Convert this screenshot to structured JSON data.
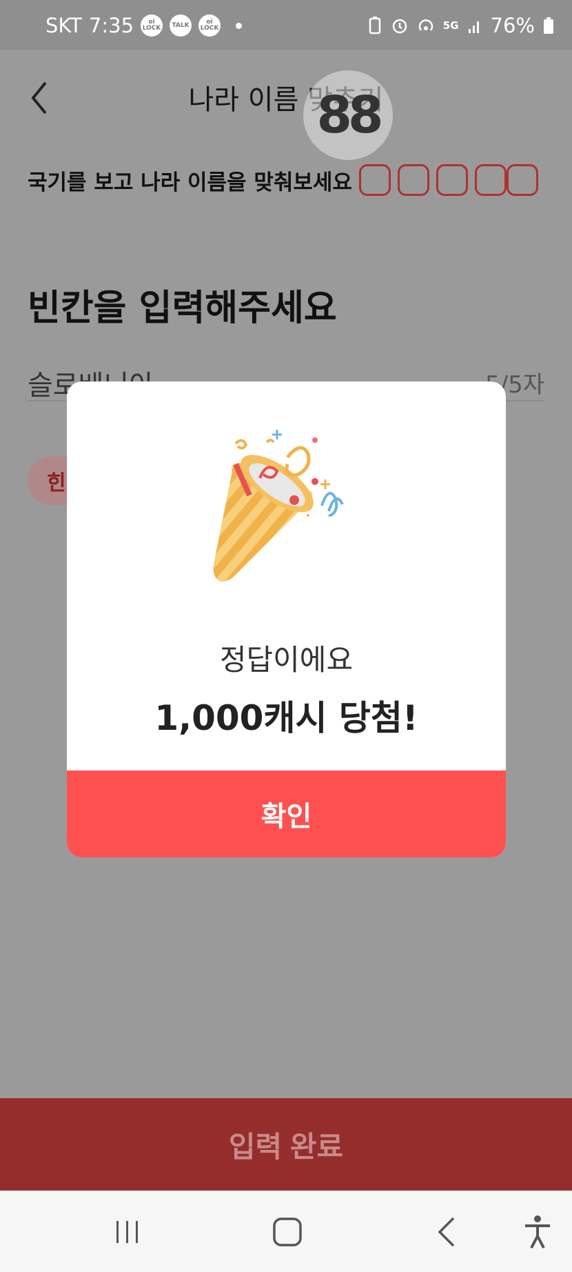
{
  "status_bar": {
    "carrier": "SKT",
    "time": "7:35",
    "badges": [
      "oi LOCK",
      "TALK",
      "oi LOCK"
    ],
    "network": "5G",
    "battery": "76%"
  },
  "header": {
    "title": "나라 이름 맞추기",
    "timer": "88"
  },
  "question": {
    "instruction": "국기를 보고 나라 이름을 맞춰보세요",
    "answer_slots": 5
  },
  "answer": {
    "subtitle": "빈칸을 입력해주세요",
    "input_value": "슬로베니아",
    "char_counter": "5/5자",
    "hint_label": "힌트"
  },
  "modal": {
    "icon": "party-popper-icon",
    "message": "정답이에요",
    "reward": "1,000캐시 당첨!",
    "confirm_label": "확인"
  },
  "footer": {
    "submit_label": "입력 완료"
  },
  "nav_bar": {
    "icons": [
      "recent-apps-icon",
      "home-icon",
      "back-icon",
      "accessibility-icon"
    ]
  },
  "colors": {
    "accent": "#ff5050",
    "dim_overlay": "#9a9a9a",
    "submit_dimmed": "#962d2d"
  }
}
